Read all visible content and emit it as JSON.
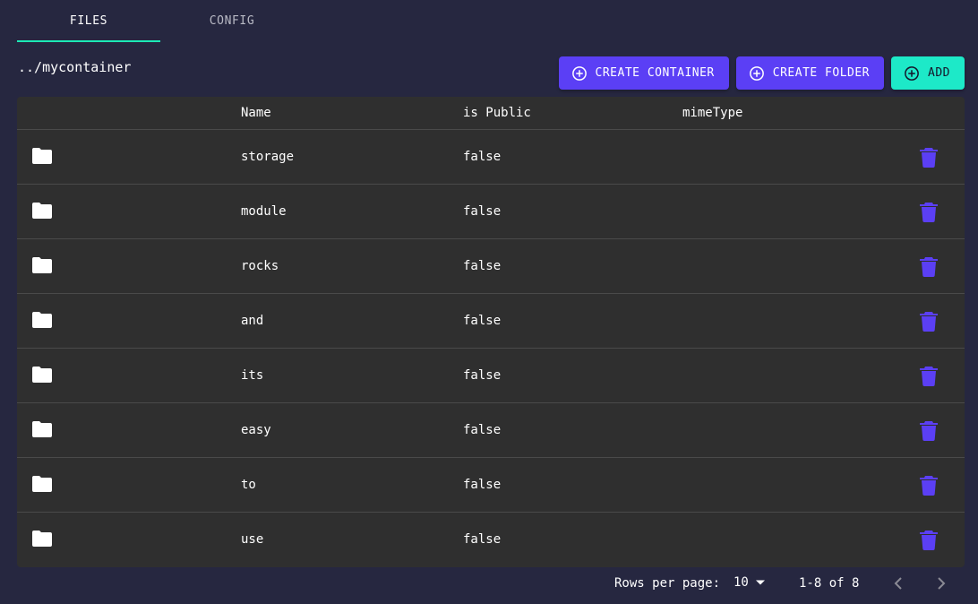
{
  "tabs": [
    {
      "label": "FILES",
      "active": true
    },
    {
      "label": "CONFIG",
      "active": false
    }
  ],
  "breadcrumb": "../mycontainer",
  "actions": {
    "create_container": "CREATE CONTAINER",
    "create_folder": "CREATE FOLDER",
    "add": "ADD"
  },
  "table": {
    "columns": [
      "",
      "Name",
      "is Public",
      "mimeType"
    ],
    "rows": [
      {
        "icon": "folder-icon",
        "name": "storage",
        "is_public": "false",
        "mime": ""
      },
      {
        "icon": "folder-icon",
        "name": "module",
        "is_public": "false",
        "mime": ""
      },
      {
        "icon": "folder-icon",
        "name": "rocks",
        "is_public": "false",
        "mime": ""
      },
      {
        "icon": "folder-icon",
        "name": "and",
        "is_public": "false",
        "mime": ""
      },
      {
        "icon": "folder-icon",
        "name": "its",
        "is_public": "false",
        "mime": ""
      },
      {
        "icon": "folder-icon",
        "name": "easy",
        "is_public": "false",
        "mime": ""
      },
      {
        "icon": "folder-icon",
        "name": "to",
        "is_public": "false",
        "mime": ""
      },
      {
        "icon": "folder-icon",
        "name": "use",
        "is_public": "false",
        "mime": ""
      }
    ]
  },
  "pagination": {
    "rows_per_page_label": "Rows per page:",
    "rows_per_page": "10",
    "range": "1-8 of 8"
  },
  "colors": {
    "background": "#262740",
    "accent": "#1de9c8",
    "primary": "#5b3ff5",
    "table_bg": "#2f2f2f",
    "delete_icon": "#5b3ff5"
  }
}
